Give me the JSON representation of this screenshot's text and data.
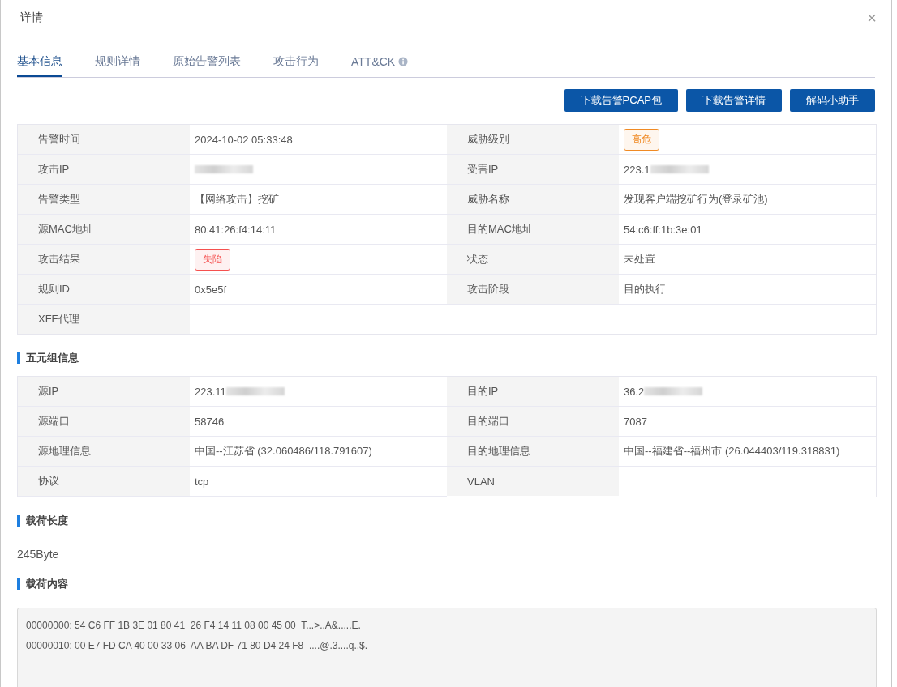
{
  "dialog": {
    "title": "详情",
    "close": "×"
  },
  "tabs": [
    {
      "label": "基本信息",
      "selected": true,
      "info": false
    },
    {
      "label": "规则详情",
      "selected": false,
      "info": false
    },
    {
      "label": "原始告警列表",
      "selected": false,
      "info": false
    },
    {
      "label": "攻击行为",
      "selected": false,
      "info": false
    },
    {
      "label": "ATT&CK",
      "selected": false,
      "info": true
    }
  ],
  "buttons": [
    "下载告警PCAP包",
    "下载告警详情",
    "解码小助手"
  ],
  "basic_info": [
    [
      {
        "label": "告警时间",
        "value": "2024-10-02 05:33:48",
        "kind": "text"
      },
      {
        "label": "威胁级别",
        "value": "高危",
        "kind": "tag",
        "color": "#f08a24"
      }
    ],
    [
      {
        "label": "攻击IP",
        "kind": "redacted"
      },
      {
        "label": "受害IP",
        "value": "223.1",
        "kind": "redacted"
      }
    ],
    [
      {
        "label": "告警类型",
        "value": "【网络攻击】挖矿",
        "kind": "text"
      },
      {
        "label": "威胁名称",
        "value": "发现客户端挖矿行为(登录矿池)",
        "kind": "text"
      }
    ],
    [
      {
        "label": "源MAC地址",
        "value": "80:41:26:f4:14:11",
        "kind": "text"
      },
      {
        "label": "目的MAC地址",
        "value": "54:c6:ff:1b:3e:01",
        "kind": "text"
      }
    ],
    [
      {
        "label": "攻击结果",
        "value": "失陷",
        "kind": "tag",
        "color": "#f5504f"
      },
      {
        "label": "状态",
        "value": "未处置",
        "kind": "text"
      }
    ],
    [
      {
        "label": "规则ID",
        "value": "0x5e5f",
        "kind": "text"
      },
      {
        "label": "攻击阶段",
        "value": "目的执行",
        "kind": "text"
      }
    ],
    [
      {
        "label": "XFF代理",
        "kind": "text"
      }
    ]
  ],
  "five_tuple": {
    "title": "五元组信息",
    "rows": [
      [
        {
          "label": "源IP",
          "value": "223.11",
          "kind": "redacted"
        },
        {
          "label": "目的IP",
          "value": "36.2",
          "kind": "redacted"
        }
      ],
      [
        {
          "label": "源端口",
          "value": "58746",
          "kind": "text"
        },
        {
          "label": "目的端口",
          "value": "7087",
          "kind": "text"
        }
      ],
      [
        {
          "label": "源地理信息",
          "value": "中国--江苏省 (32.060486/118.791607)",
          "kind": "text"
        },
        {
          "label": "目的地理信息",
          "value": "中国--福建省--福州市 (26.044403/119.318831)",
          "kind": "text"
        }
      ],
      [
        {
          "label": "协议",
          "value": "tcp",
          "kind": "text"
        },
        {
          "label": "VLAN",
          "kind": "text"
        }
      ]
    ]
  },
  "payload_length": {
    "title": "载荷长度",
    "value": "245Byte"
  },
  "payload_content": {
    "title": "载荷内容",
    "lines": [
      "00000000: 54 C6 FF 1B 3E 01 80 41  26 F4 14 11 08 00 45 00  T...>..A&.....E.",
      "00000010: 00 E7 FD CA 40 00 33 06  AA BA DF 71 80 D4 24 F8  ....@.3....q..$."
    ]
  }
}
